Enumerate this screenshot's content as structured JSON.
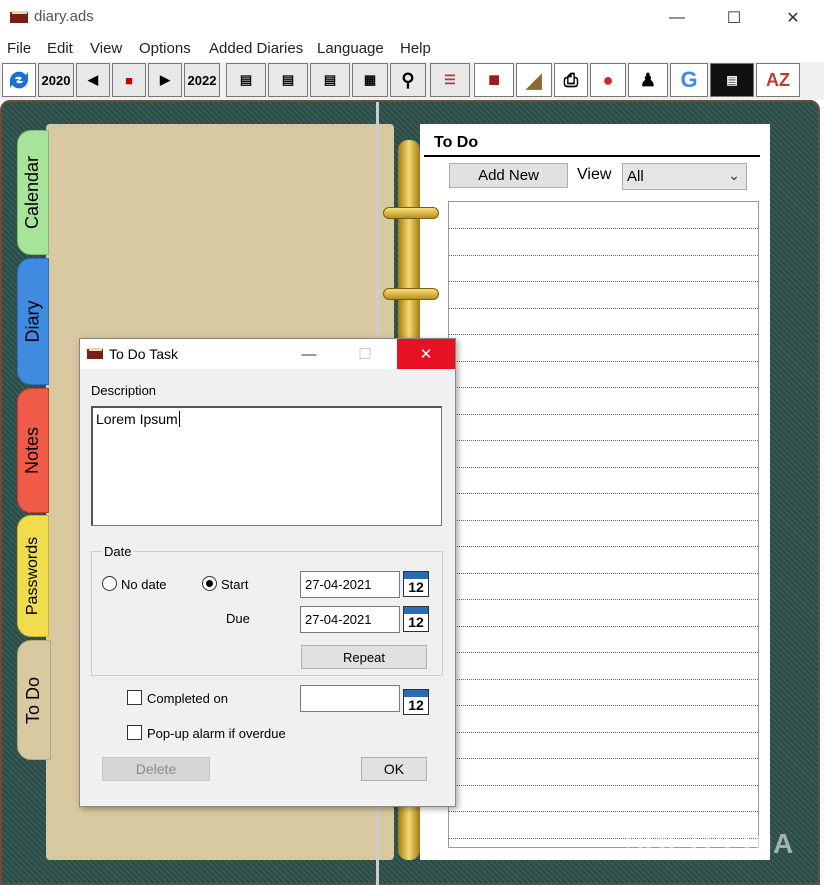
{
  "window": {
    "title": "diary.ads"
  },
  "menu": [
    "File",
    "Edit",
    "View",
    "Options",
    "Added Diaries",
    "Language",
    "Help"
  ],
  "toolbar": {
    "year_prev": "2020",
    "year_next": "2022",
    "sort_label": "AZ"
  },
  "tabs": [
    "Calendar",
    "Diary",
    "Notes",
    "Passwords",
    "To Do"
  ],
  "todo": {
    "title": "To Do",
    "add_new": "Add New",
    "view_label": "View",
    "view_value": "All"
  },
  "dialog": {
    "title": "To Do Task",
    "description_label": "Description",
    "description_value": "Lorem Ipsum",
    "date_group": "Date",
    "no_date": "No date",
    "start": "Start",
    "due": "Due",
    "start_value": "27-04-2021",
    "due_value": "27-04-2021",
    "calendar_day": "12",
    "repeat": "Repeat",
    "completed_on": "Completed on",
    "completed_value": "",
    "popup_alarm": "Pop-up alarm if overdue",
    "delete": "Delete",
    "ok": "OK"
  },
  "watermark": "SOFTPEDIA"
}
